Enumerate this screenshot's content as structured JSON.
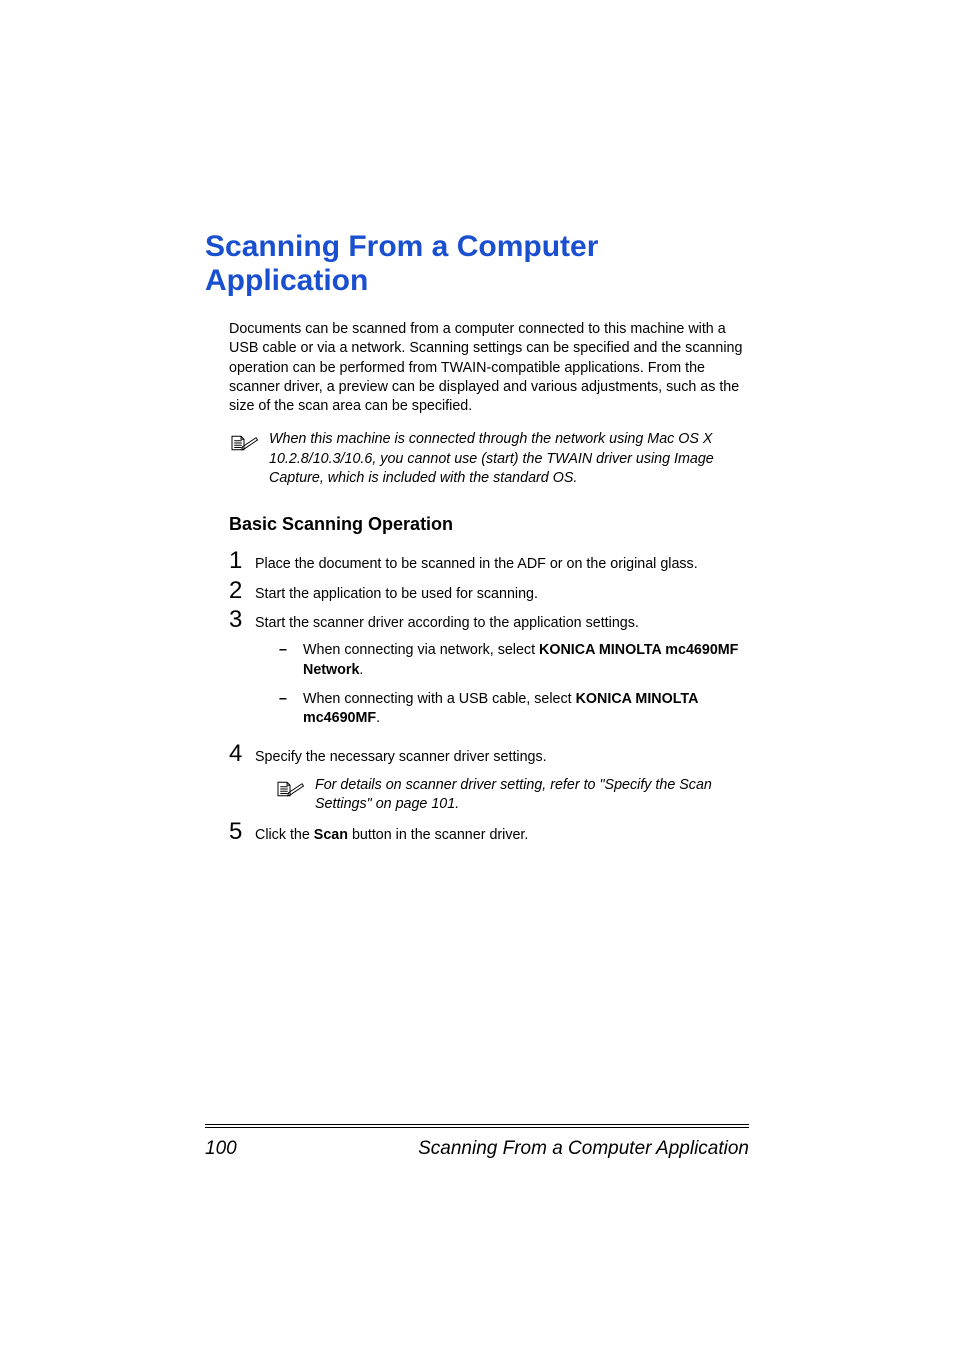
{
  "heading": "Scanning From a Computer Application",
  "intro": "Documents can be scanned from a computer connected to this machine with a USB cable or via a network. Scanning settings can be specified and the scanning operation can be performed from TWAIN-compatible applications. From the scanner driver, a preview can be displayed and various adjustments, such as the size of the scan area can be specified.",
  "note1": "When this machine is connected through the network using Mac OS X 10.2.8/10.3/10.6, you cannot use (start) the TWAIN driver using Image Capture, which is included with the standard OS.",
  "subheading": "Basic Scanning Operation",
  "steps": {
    "s1": {
      "num": "1",
      "text": "Place the document to be scanned in the ADF or on the original glass."
    },
    "s2": {
      "num": "2",
      "text": "Start the application to be used for scanning."
    },
    "s3": {
      "num": "3",
      "text": "Start the scanner driver according to the application settings.",
      "sub_a_pre": "When connecting via network, select ",
      "sub_a_bold": "KONICA MINOLTA mc4690MF Network",
      "sub_a_post": ".",
      "sub_b_pre": "When connecting with a USB cable, select ",
      "sub_b_bold": "KONICA MINOLTA mc4690MF",
      "sub_b_post": "."
    },
    "s4": {
      "num": "4",
      "text": "Specify the necessary scanner driver settings.",
      "note": "For details on scanner driver setting, refer to \"Specify the Scan Settings\" on page 101."
    },
    "s5": {
      "num": "5",
      "pre": "Click the ",
      "bold": "Scan",
      "post": " button in the scanner driver."
    }
  },
  "footer": {
    "pagenum": "100",
    "title": "Scanning From a Computer Application"
  }
}
